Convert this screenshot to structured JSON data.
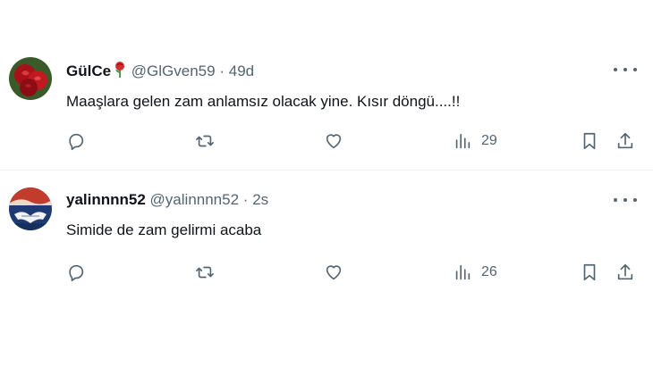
{
  "tweets": [
    {
      "display_name": "GülCe",
      "handle": "@GlGven59",
      "separator": "·",
      "time": "49d",
      "text": "Maaşlara gelen zam anlamsız olacak yine. Kısır döngü....!!",
      "views": "29",
      "avatar_icon": "red-roses-avatar"
    },
    {
      "display_name": "yalinnnn52",
      "handle": "@yalinnnn52",
      "separator": "·",
      "time": "2s",
      "text": "Simide de zam gelirmi acaba",
      "views": "26",
      "avatar_icon": "handshake-avatar"
    }
  ],
  "icons": {
    "reply": "reply-icon",
    "retweet": "retweet-icon",
    "like": "heart-icon",
    "views": "views-icon",
    "bookmark": "bookmark-icon",
    "share": "share-icon",
    "more": "more-icon",
    "name_emoji": "rose-icon"
  },
  "colors": {
    "text_primary": "#0f1419",
    "text_secondary": "#536471",
    "divider": "#eff3f4",
    "icon": "#536471"
  }
}
